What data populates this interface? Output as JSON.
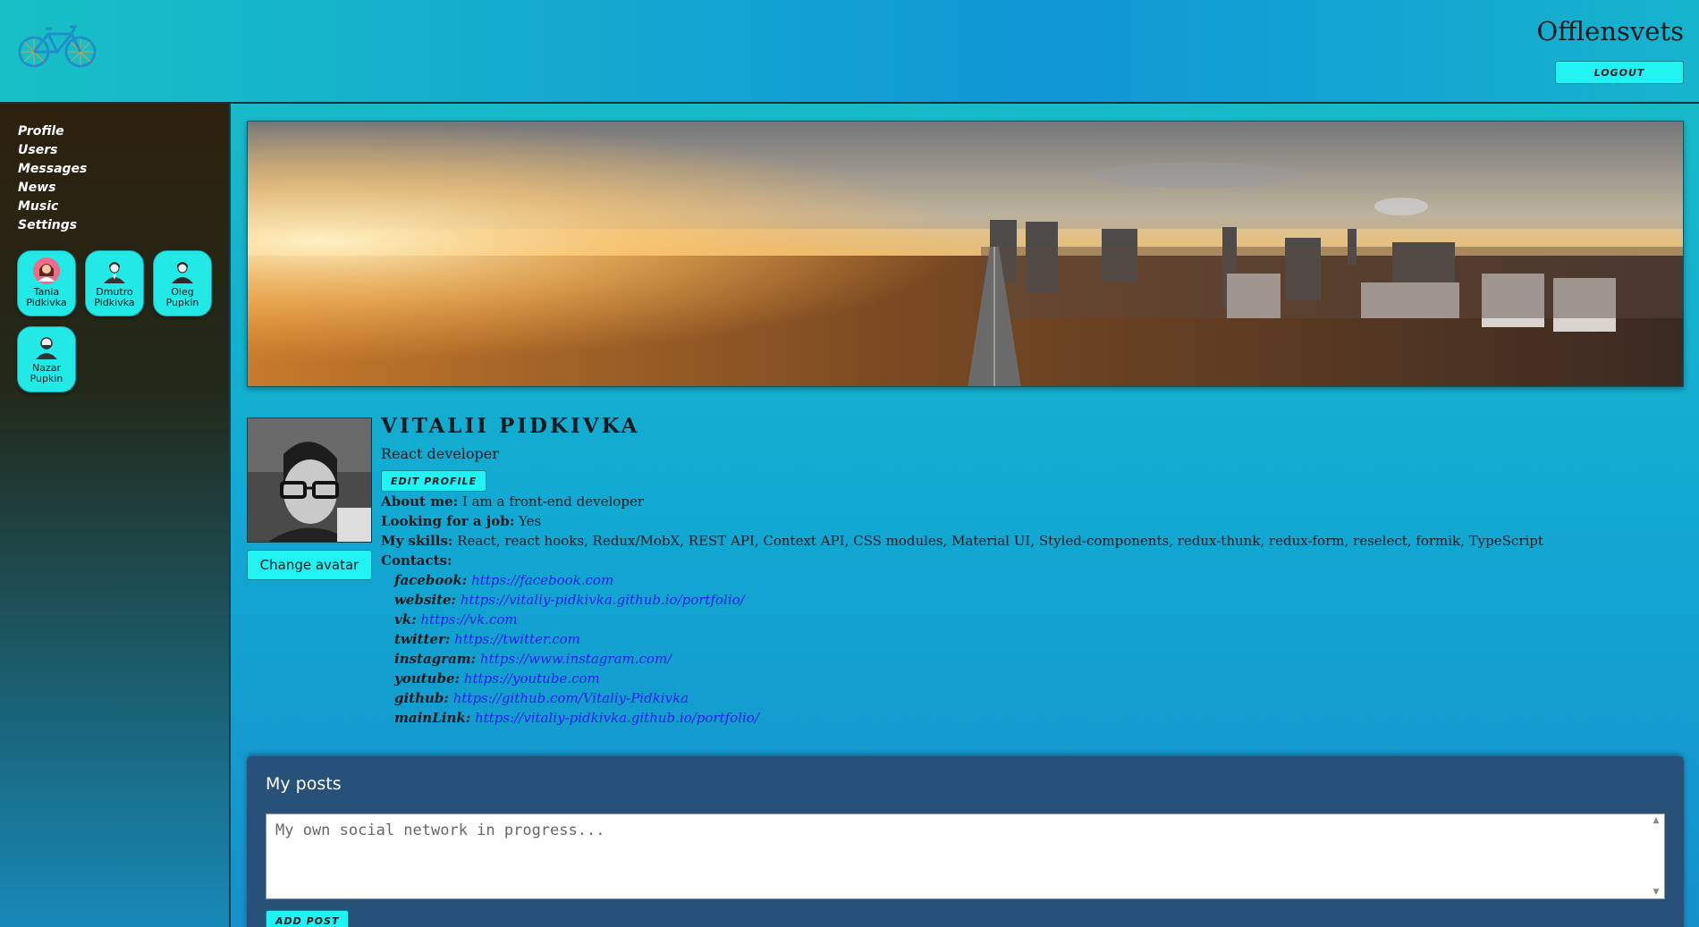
{
  "header": {
    "logo_icon": "bicycle-icon",
    "app_title": "Offlensvets",
    "logout_label": "LOGOUT"
  },
  "sidebar": {
    "nav": [
      {
        "label": "Profile"
      },
      {
        "label": "Users"
      },
      {
        "label": "Messages"
      },
      {
        "label": "News"
      },
      {
        "label": "Music"
      },
      {
        "label": "Settings"
      }
    ],
    "friends": [
      {
        "name": "Tania Pidkivka",
        "icon": "female-avatar-icon"
      },
      {
        "name": "Dmutro Pidkivka",
        "icon": "male-avatar-icon"
      },
      {
        "name": "Oleg Pupkin",
        "icon": "male-avatar-icon"
      },
      {
        "name": "Nazar Pupkin",
        "icon": "bearded-avatar-icon"
      }
    ]
  },
  "profile": {
    "cover_image": "city-sunset-panorama",
    "change_avatar_label": "Change avatar",
    "name": "VITALII PIDKIVKA",
    "status": "React developer",
    "edit_profile_label": "EDIT PROFILE",
    "about_me": {
      "label": "About me:",
      "value": "I am a front-end developer"
    },
    "looking_for_job": {
      "label": "Looking for a job:",
      "value": "Yes"
    },
    "skills": {
      "label": "My skills:",
      "value": "React, react hooks, Redux/MobX, REST API, Context API, CSS modules, Material UI, Styled-components, redux-thunk, redux-form, reselect, formik, TypeScript"
    },
    "contacts_label": "Contacts:",
    "contacts": [
      {
        "key": "facebook:",
        "value": "https://facebook.com"
      },
      {
        "key": "website:",
        "value": "https://vitaliy-pidkivka.github.io/portfolio/"
      },
      {
        "key": "vk:",
        "value": "https://vk.com"
      },
      {
        "key": "twitter:",
        "value": "https://twitter.com"
      },
      {
        "key": "instagram:",
        "value": "https://www.instagram.com/"
      },
      {
        "key": "youtube:",
        "value": "https://youtube.com"
      },
      {
        "key": "github:",
        "value": "https://github.com/Vitaliy-Pidkivka"
      },
      {
        "key": "mainLink:",
        "value": "https://vitaliy-pidkivka.github.io/portfolio/"
      }
    ]
  },
  "posts": {
    "title": "My posts",
    "placeholder": "My own social network in progress...",
    "add_post_label": "ADD POST"
  },
  "colors": {
    "accent": "#21f3f2",
    "link": "#1a22e6",
    "posts_bg": "#275178",
    "sidebar_top": "#2e200e"
  }
}
